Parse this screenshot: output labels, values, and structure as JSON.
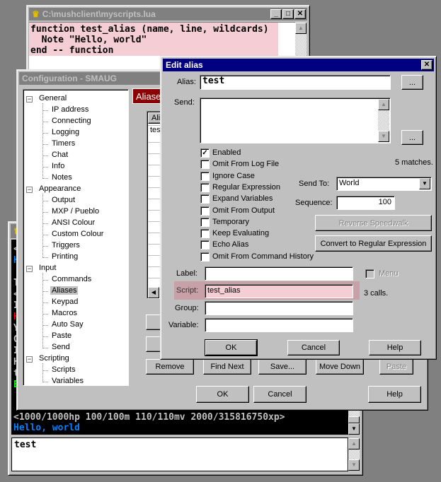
{
  "script_editor": {
    "title": "C:\\mushclient\\myscripts.lua",
    "lines": [
      "function test_alias (name, line, wildcards)",
      "  Note \"Hello, world\"",
      "end -- function"
    ],
    "highlight_color": "#f5cdd4"
  },
  "mush_window": {
    "output_clipped_chars": [
      {
        "text": "<",
        "color": "#c0c0c0"
      },
      {
        "text": "H",
        "color": "#0080ff"
      },
      {
        "text": "",
        "color": "#c0c0c0"
      },
      {
        "text": "T",
        "color": "#c0c0c0"
      },
      {
        "text": "<",
        "color": "#c0c0c0"
      },
      {
        "text": "I",
        "color": "#c0c0c0"
      },
      {
        "text": "H",
        "color": "#ff0000"
      },
      {
        "text": "Y",
        "color": "#c0c0c0"
      },
      {
        "text": "G",
        "color": "#c0c0c0"
      },
      {
        "text": "I",
        "color": "#c0c0c0"
      },
      {
        "text": "H",
        "color": "#c0c0c0"
      },
      {
        "text": "t",
        "color": "#c0c0c0"
      },
      {
        "text": "E",
        "color": "#00ff00"
      }
    ],
    "status_line": "<1000/1000hp 100/100m 110/110mv 2000/315816750xp>",
    "hello_line": "Hello, world",
    "input": "test"
  },
  "config": {
    "title": "Configuration - SMAUG",
    "tab_label": "Aliases",
    "list_header": "Alias",
    "list_first": "test",
    "tree": [
      {
        "label": "General",
        "level": 0
      },
      {
        "label": "IP address",
        "level": 1
      },
      {
        "label": "Connecting",
        "level": 1
      },
      {
        "label": "Logging",
        "level": 1
      },
      {
        "label": "Timers",
        "level": 1
      },
      {
        "label": "Chat",
        "level": 1
      },
      {
        "label": "Info",
        "level": 1
      },
      {
        "label": "Notes",
        "level": 1
      },
      {
        "label": "Appearance",
        "level": 0
      },
      {
        "label": "Output",
        "level": 1
      },
      {
        "label": "MXP / Pueblo",
        "level": 1
      },
      {
        "label": "ANSI Colour",
        "level": 1
      },
      {
        "label": "Custom Colour",
        "level": 1
      },
      {
        "label": "Triggers",
        "level": 1
      },
      {
        "label": "Printing",
        "level": 1
      },
      {
        "label": "Input",
        "level": 0
      },
      {
        "label": "Commands",
        "level": 1
      },
      {
        "label": "Aliases",
        "level": 1,
        "selected": true
      },
      {
        "label": "Keypad",
        "level": 1
      },
      {
        "label": "Macros",
        "level": 1
      },
      {
        "label": "Auto Say",
        "level": 1
      },
      {
        "label": "Paste",
        "level": 1
      },
      {
        "label": "Send",
        "level": 1
      },
      {
        "label": "Scripting",
        "level": 0
      },
      {
        "label": "Scripts",
        "level": 1
      },
      {
        "label": "Variables",
        "level": 1
      }
    ],
    "buttons": {
      "remove": "Remove",
      "find_next": "Find Next",
      "save": "Save...",
      "move_down": "Move Down",
      "paste": "Paste",
      "ok": "OK",
      "cancel": "Cancel",
      "help": "Help"
    },
    "tab_color": "#8b0000"
  },
  "edit_alias": {
    "title": "Edit alias",
    "alias_label": "Alias:",
    "alias_value": "test",
    "send_label": "Send:",
    "send_value": "",
    "ellipsis": "...",
    "checkboxes": [
      {
        "label": "Enabled",
        "checked": true
      },
      {
        "label": "Omit From Log File",
        "checked": false
      },
      {
        "label": "Ignore Case",
        "checked": false
      },
      {
        "label": "Regular Expression",
        "checked": false
      },
      {
        "label": "Expand Variables",
        "checked": false
      },
      {
        "label": "Omit From Output",
        "checked": false
      },
      {
        "label": "Temporary",
        "checked": false
      },
      {
        "label": "Keep Evaluating",
        "checked": false
      },
      {
        "label": "Echo Alias",
        "checked": false
      },
      {
        "label": "Omit From Command History",
        "checked": false
      }
    ],
    "matches": "5 matches.",
    "send_to_label": "Send To:",
    "send_to_value": "World",
    "sequence_label": "Sequence:",
    "sequence_value": "100",
    "reverse_speedwalk": "Reverse Speedwalk",
    "convert_regex": "Convert to Regular Expression",
    "label_label": "Label:",
    "label_value": "",
    "menu_label": "Menu",
    "script_label": "Script:",
    "script_value": "test_alias",
    "calls": "3 calls.",
    "group_label": "Group:",
    "group_value": "",
    "variable_label": "Variable:",
    "variable_value": "",
    "ok": "OK",
    "cancel": "Cancel",
    "help": "Help"
  }
}
